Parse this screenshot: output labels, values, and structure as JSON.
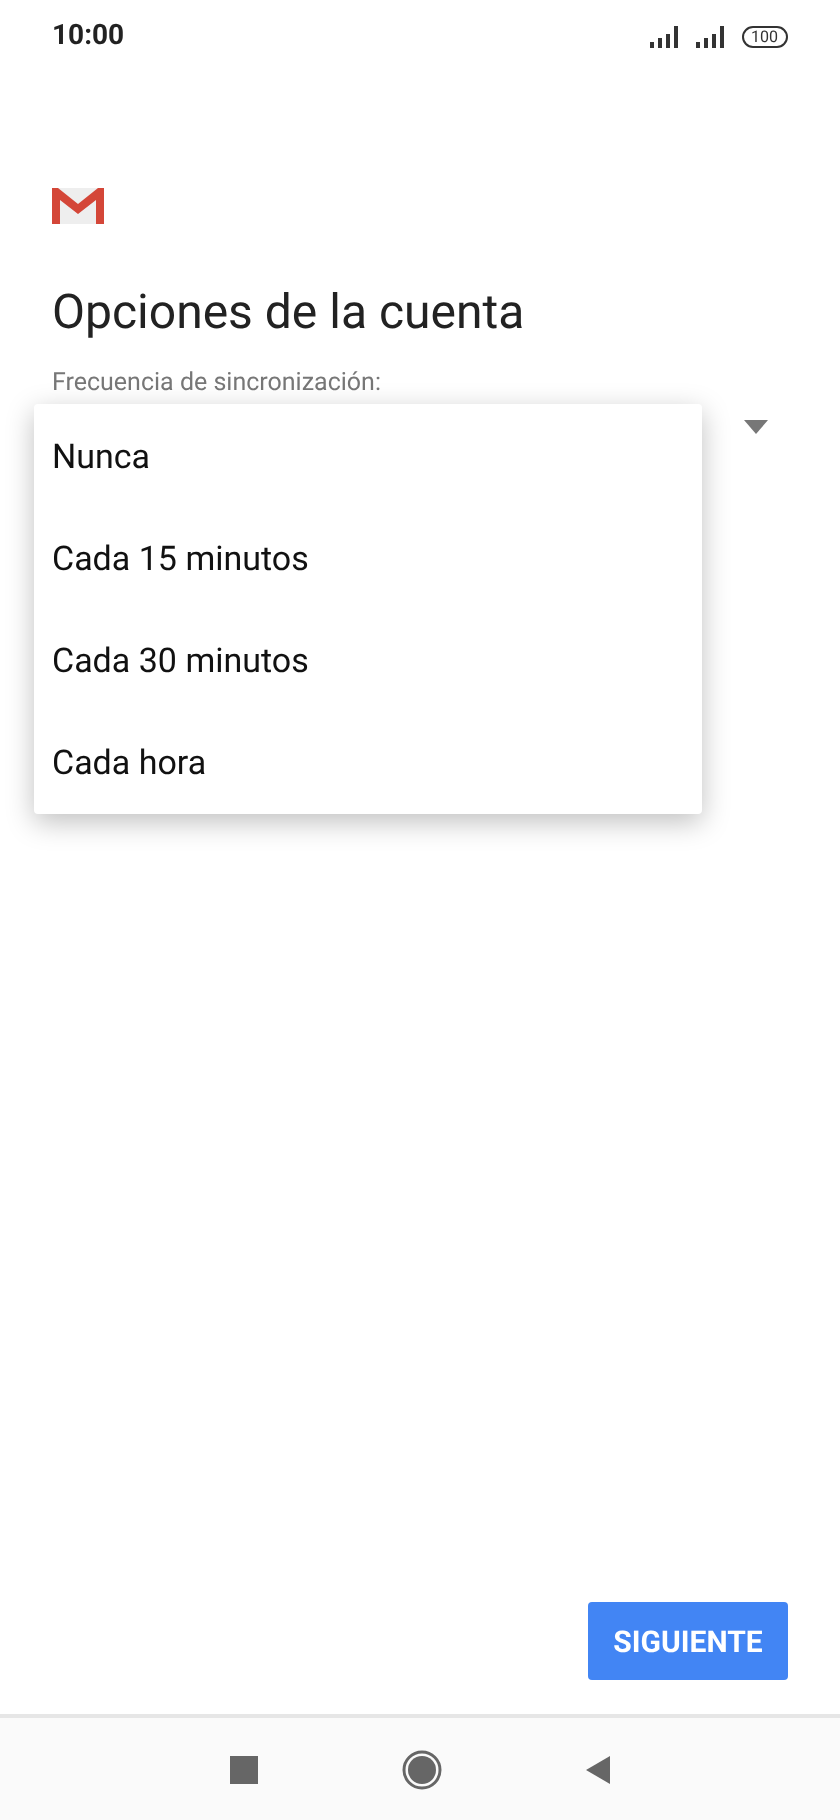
{
  "status_bar": {
    "time": "10:00",
    "battery": "100"
  },
  "title": "Opciones de la cuenta",
  "sync_field": {
    "label": "Frecuencia de sincronización:",
    "expanded": true
  },
  "menu": [
    {
      "label": "Nunca"
    },
    {
      "label": "Cada 15 minutos"
    },
    {
      "label": "Cada 30 minutos"
    },
    {
      "label": "Cada hora"
    }
  ],
  "next_button": "SIGUIENTE"
}
